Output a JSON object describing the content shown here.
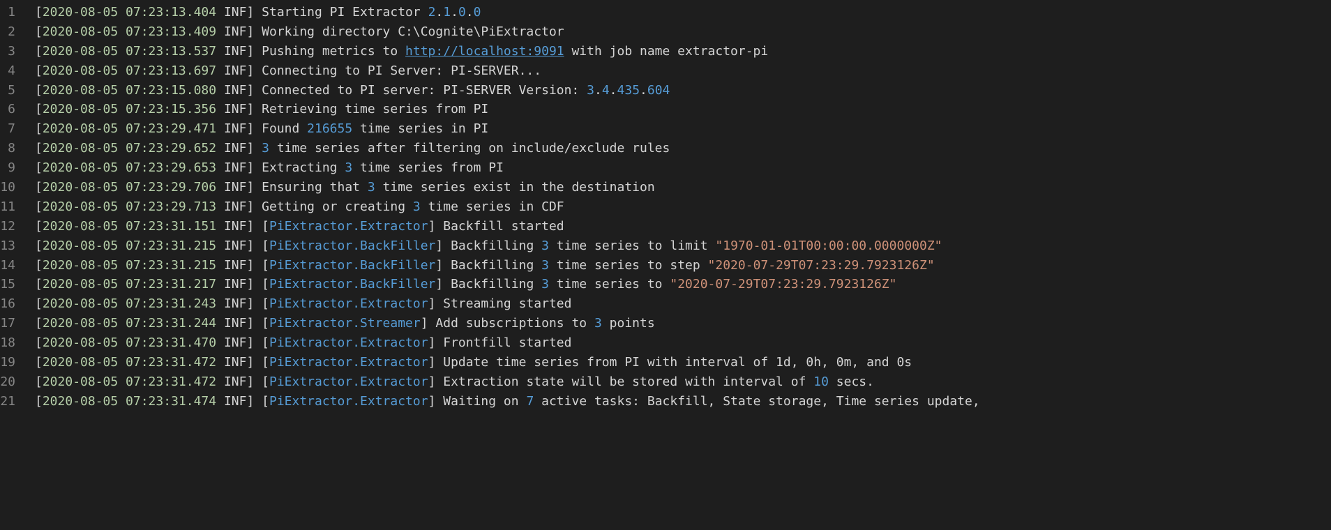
{
  "lines": [
    {
      "n": "1",
      "segs": [
        {
          "c": "bracket",
          "t": "["
        },
        {
          "c": "ts",
          "t": "2020-08-05 07:23:13.404"
        },
        {
          "c": "bracket",
          "t": " "
        },
        {
          "c": "level",
          "t": "INF"
        },
        {
          "c": "bracket",
          "t": "] "
        },
        {
          "c": "text",
          "t": "Starting PI Extractor "
        },
        {
          "c": "num",
          "t": "2"
        },
        {
          "c": "text",
          "t": "."
        },
        {
          "c": "num",
          "t": "1"
        },
        {
          "c": "text",
          "t": "."
        },
        {
          "c": "num",
          "t": "0"
        },
        {
          "c": "text",
          "t": "."
        },
        {
          "c": "num",
          "t": "0"
        }
      ]
    },
    {
      "n": "2",
      "segs": [
        {
          "c": "bracket",
          "t": "["
        },
        {
          "c": "ts",
          "t": "2020-08-05 07:23:13.409"
        },
        {
          "c": "bracket",
          "t": " "
        },
        {
          "c": "level",
          "t": "INF"
        },
        {
          "c": "bracket",
          "t": "] "
        },
        {
          "c": "text",
          "t": "Working directory C:\\Cognite\\PiExtractor"
        }
      ]
    },
    {
      "n": "3",
      "segs": [
        {
          "c": "bracket",
          "t": "["
        },
        {
          "c": "ts",
          "t": "2020-08-05 07:23:13.537"
        },
        {
          "c": "bracket",
          "t": " "
        },
        {
          "c": "level",
          "t": "INF"
        },
        {
          "c": "bracket",
          "t": "] "
        },
        {
          "c": "text",
          "t": "Pushing metrics to "
        },
        {
          "c": "link",
          "t": "http://localhost:9091"
        },
        {
          "c": "text",
          "t": " with job name extractor-pi"
        }
      ]
    },
    {
      "n": "4",
      "segs": [
        {
          "c": "bracket",
          "t": "["
        },
        {
          "c": "ts",
          "t": "2020-08-05 07:23:13.697"
        },
        {
          "c": "bracket",
          "t": " "
        },
        {
          "c": "level",
          "t": "INF"
        },
        {
          "c": "bracket",
          "t": "] "
        },
        {
          "c": "text",
          "t": "Connecting to PI Server: PI-SERVER..."
        }
      ]
    },
    {
      "n": "5",
      "segs": [
        {
          "c": "bracket",
          "t": "["
        },
        {
          "c": "ts",
          "t": "2020-08-05 07:23:15.080"
        },
        {
          "c": "bracket",
          "t": " "
        },
        {
          "c": "level",
          "t": "INF"
        },
        {
          "c": "bracket",
          "t": "] "
        },
        {
          "c": "text",
          "t": "Connected to PI server: PI-SERVER Version: "
        },
        {
          "c": "num",
          "t": "3"
        },
        {
          "c": "text",
          "t": "."
        },
        {
          "c": "num",
          "t": "4"
        },
        {
          "c": "text",
          "t": "."
        },
        {
          "c": "num",
          "t": "435"
        },
        {
          "c": "text",
          "t": "."
        },
        {
          "c": "num",
          "t": "604"
        }
      ]
    },
    {
      "n": "6",
      "segs": [
        {
          "c": "bracket",
          "t": "["
        },
        {
          "c": "ts",
          "t": "2020-08-05 07:23:15.356"
        },
        {
          "c": "bracket",
          "t": " "
        },
        {
          "c": "level",
          "t": "INF"
        },
        {
          "c": "bracket",
          "t": "] "
        },
        {
          "c": "text",
          "t": "Retrieving time series from PI"
        }
      ]
    },
    {
      "n": "7",
      "segs": [
        {
          "c": "bracket",
          "t": "["
        },
        {
          "c": "ts",
          "t": "2020-08-05 07:23:29.471"
        },
        {
          "c": "bracket",
          "t": " "
        },
        {
          "c": "level",
          "t": "INF"
        },
        {
          "c": "bracket",
          "t": "] "
        },
        {
          "c": "text",
          "t": "Found "
        },
        {
          "c": "num",
          "t": "216655"
        },
        {
          "c": "text",
          "t": " time series in PI"
        }
      ]
    },
    {
      "n": "8",
      "segs": [
        {
          "c": "bracket",
          "t": "["
        },
        {
          "c": "ts",
          "t": "2020-08-05 07:23:29.652"
        },
        {
          "c": "bracket",
          "t": " "
        },
        {
          "c": "level",
          "t": "INF"
        },
        {
          "c": "bracket",
          "t": "] "
        },
        {
          "c": "num",
          "t": "3"
        },
        {
          "c": "text",
          "t": " time series after filtering on include/exclude rules"
        }
      ]
    },
    {
      "n": "9",
      "segs": [
        {
          "c": "bracket",
          "t": "["
        },
        {
          "c": "ts",
          "t": "2020-08-05 07:23:29.653"
        },
        {
          "c": "bracket",
          "t": " "
        },
        {
          "c": "level",
          "t": "INF"
        },
        {
          "c": "bracket",
          "t": "] "
        },
        {
          "c": "text",
          "t": "Extracting "
        },
        {
          "c": "num",
          "t": "3"
        },
        {
          "c": "text",
          "t": " time series from PI"
        }
      ]
    },
    {
      "n": "10",
      "segs": [
        {
          "c": "bracket",
          "t": "["
        },
        {
          "c": "ts",
          "t": "2020-08-05 07:23:29.706"
        },
        {
          "c": "bracket",
          "t": " "
        },
        {
          "c": "level",
          "t": "INF"
        },
        {
          "c": "bracket",
          "t": "] "
        },
        {
          "c": "text",
          "t": "Ensuring that "
        },
        {
          "c": "num",
          "t": "3"
        },
        {
          "c": "text",
          "t": " time series exist in the destination"
        }
      ]
    },
    {
      "n": "11",
      "segs": [
        {
          "c": "bracket",
          "t": "["
        },
        {
          "c": "ts",
          "t": "2020-08-05 07:23:29.713"
        },
        {
          "c": "bracket",
          "t": " "
        },
        {
          "c": "level",
          "t": "INF"
        },
        {
          "c": "bracket",
          "t": "] "
        },
        {
          "c": "text",
          "t": "Getting or creating "
        },
        {
          "c": "num",
          "t": "3"
        },
        {
          "c": "text",
          "t": " time series in CDF"
        }
      ]
    },
    {
      "n": "12",
      "segs": [
        {
          "c": "bracket",
          "t": "["
        },
        {
          "c": "ts",
          "t": "2020-08-05 07:23:31.151"
        },
        {
          "c": "bracket",
          "t": " "
        },
        {
          "c": "level",
          "t": "INF"
        },
        {
          "c": "bracket",
          "t": "] "
        },
        {
          "c": "text",
          "t": "["
        },
        {
          "c": "class",
          "t": "PiExtractor.Extractor"
        },
        {
          "c": "text",
          "t": "] Backfill started"
        }
      ]
    },
    {
      "n": "13",
      "segs": [
        {
          "c": "bracket",
          "t": "["
        },
        {
          "c": "ts",
          "t": "2020-08-05 07:23:31.215"
        },
        {
          "c": "bracket",
          "t": " "
        },
        {
          "c": "level",
          "t": "INF"
        },
        {
          "c": "bracket",
          "t": "] "
        },
        {
          "c": "text",
          "t": "["
        },
        {
          "c": "class",
          "t": "PiExtractor.BackFiller"
        },
        {
          "c": "text",
          "t": "] Backfilling "
        },
        {
          "c": "num",
          "t": "3"
        },
        {
          "c": "text",
          "t": " time series to limit "
        },
        {
          "c": "str",
          "t": "\"1970-01-01T00:00:00.0000000Z\""
        }
      ]
    },
    {
      "n": "14",
      "segs": [
        {
          "c": "bracket",
          "t": "["
        },
        {
          "c": "ts",
          "t": "2020-08-05 07:23:31.215"
        },
        {
          "c": "bracket",
          "t": " "
        },
        {
          "c": "level",
          "t": "INF"
        },
        {
          "c": "bracket",
          "t": "] "
        },
        {
          "c": "text",
          "t": "["
        },
        {
          "c": "class",
          "t": "PiExtractor.BackFiller"
        },
        {
          "c": "text",
          "t": "] Backfilling "
        },
        {
          "c": "num",
          "t": "3"
        },
        {
          "c": "text",
          "t": " time series to step "
        },
        {
          "c": "str",
          "t": "\"2020-07-29T07:23:29.7923126Z\""
        }
      ]
    },
    {
      "n": "15",
      "segs": [
        {
          "c": "bracket",
          "t": "["
        },
        {
          "c": "ts",
          "t": "2020-08-05 07:23:31.217"
        },
        {
          "c": "bracket",
          "t": " "
        },
        {
          "c": "level",
          "t": "INF"
        },
        {
          "c": "bracket",
          "t": "] "
        },
        {
          "c": "text",
          "t": "["
        },
        {
          "c": "class",
          "t": "PiExtractor.BackFiller"
        },
        {
          "c": "text",
          "t": "] Backfilling "
        },
        {
          "c": "num",
          "t": "3"
        },
        {
          "c": "text",
          "t": " time series to "
        },
        {
          "c": "str",
          "t": "\"2020-07-29T07:23:29.7923126Z\""
        }
      ]
    },
    {
      "n": "16",
      "segs": [
        {
          "c": "bracket",
          "t": "["
        },
        {
          "c": "ts",
          "t": "2020-08-05 07:23:31.243"
        },
        {
          "c": "bracket",
          "t": " "
        },
        {
          "c": "level",
          "t": "INF"
        },
        {
          "c": "bracket",
          "t": "] "
        },
        {
          "c": "text",
          "t": "["
        },
        {
          "c": "class",
          "t": "PiExtractor.Extractor"
        },
        {
          "c": "text",
          "t": "] Streaming started"
        }
      ]
    },
    {
      "n": "17",
      "segs": [
        {
          "c": "bracket",
          "t": "["
        },
        {
          "c": "ts",
          "t": "2020-08-05 07:23:31.244"
        },
        {
          "c": "bracket",
          "t": " "
        },
        {
          "c": "level",
          "t": "INF"
        },
        {
          "c": "bracket",
          "t": "] "
        },
        {
          "c": "text",
          "t": "["
        },
        {
          "c": "class",
          "t": "PiExtractor.Streamer"
        },
        {
          "c": "text",
          "t": "] Add subscriptions to "
        },
        {
          "c": "num",
          "t": "3"
        },
        {
          "c": "text",
          "t": " points"
        }
      ]
    },
    {
      "n": "18",
      "segs": [
        {
          "c": "bracket",
          "t": "["
        },
        {
          "c": "ts",
          "t": "2020-08-05 07:23:31.470"
        },
        {
          "c": "bracket",
          "t": " "
        },
        {
          "c": "level",
          "t": "INF"
        },
        {
          "c": "bracket",
          "t": "] "
        },
        {
          "c": "text",
          "t": "["
        },
        {
          "c": "class",
          "t": "PiExtractor.Extractor"
        },
        {
          "c": "text",
          "t": "] Frontfill started"
        }
      ]
    },
    {
      "n": "19",
      "segs": [
        {
          "c": "bracket",
          "t": "["
        },
        {
          "c": "ts",
          "t": "2020-08-05 07:23:31.472"
        },
        {
          "c": "bracket",
          "t": " "
        },
        {
          "c": "level",
          "t": "INF"
        },
        {
          "c": "bracket",
          "t": "] "
        },
        {
          "c": "text",
          "t": "["
        },
        {
          "c": "class",
          "t": "PiExtractor.Extractor"
        },
        {
          "c": "text",
          "t": "] Update time series from PI with interval of 1d, 0h, 0m, and 0s"
        }
      ]
    },
    {
      "n": "20",
      "segs": [
        {
          "c": "bracket",
          "t": "["
        },
        {
          "c": "ts",
          "t": "2020-08-05 07:23:31.472"
        },
        {
          "c": "bracket",
          "t": " "
        },
        {
          "c": "level",
          "t": "INF"
        },
        {
          "c": "bracket",
          "t": "] "
        },
        {
          "c": "text",
          "t": "["
        },
        {
          "c": "class",
          "t": "PiExtractor.Extractor"
        },
        {
          "c": "text",
          "t": "] Extraction state will be stored with interval of "
        },
        {
          "c": "num",
          "t": "10"
        },
        {
          "c": "text",
          "t": " secs."
        }
      ]
    },
    {
      "n": "21",
      "segs": [
        {
          "c": "bracket",
          "t": "["
        },
        {
          "c": "ts",
          "t": "2020-08-05 07:23:31.474"
        },
        {
          "c": "bracket",
          "t": " "
        },
        {
          "c": "level",
          "t": "INF"
        },
        {
          "c": "bracket",
          "t": "] "
        },
        {
          "c": "text",
          "t": "["
        },
        {
          "c": "class",
          "t": "PiExtractor.Extractor"
        },
        {
          "c": "text",
          "t": "] Waiting on "
        },
        {
          "c": "num",
          "t": "7"
        },
        {
          "c": "text",
          "t": " active tasks: Backfill, State storage, Time series update,"
        }
      ]
    }
  ]
}
